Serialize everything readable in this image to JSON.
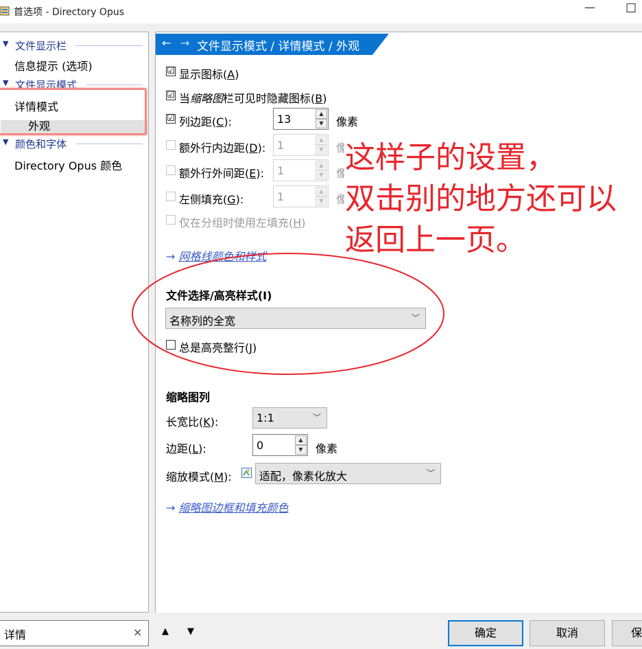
{
  "window": {
    "title": "首选项 - Directory Opus",
    "minimize": "—",
    "maximize": "☐"
  },
  "tree": {
    "groups": [
      {
        "label": "文件显示栏",
        "items": [
          "信息提示 (选项)"
        ]
      },
      {
        "label": "文件显示模式",
        "items": [
          "详情模式"
        ],
        "subitems": [
          "外观"
        ]
      },
      {
        "label": "颜色和字体",
        "items": [
          "Directory Opus 颜色"
        ]
      }
    ]
  },
  "banner": {
    "back": "←",
    "forward": "→",
    "path": "文件显示模式 / 详情模式 / 外观"
  },
  "options": {
    "show_icons": {
      "label": "显示图标(",
      "key": "A",
      "tail": ")",
      "checked": "☑"
    },
    "hide_icons": {
      "prefix": "当",
      "italic": "缩略图",
      "label": "栏可见时隐藏图标(",
      "key": "B",
      "tail": ")",
      "checked": "☑"
    },
    "column_margin": {
      "label": "列边距(",
      "key": "C",
      "tail": "):",
      "value": "13",
      "unit": "像素",
      "checked": "☑"
    },
    "extra_inner": {
      "label": "额外行内边距(",
      "key": "D",
      "tail": "):",
      "value": "1",
      "unit": "像素"
    },
    "extra_outer": {
      "label": "额外行外间距(",
      "key": "E",
      "tail": "):",
      "value": "1",
      "unit": "像素"
    },
    "left_pad": {
      "label": "左侧填充(",
      "key": "G",
      "tail": "):",
      "value": "1",
      "unit": "像素"
    },
    "group_only": {
      "label": "仅在分组时使用左填充(",
      "key": "H",
      "tail": ")"
    }
  },
  "grid_link": {
    "arrow": "→",
    "text": "网格线颜色和样式"
  },
  "selection": {
    "title": "文件选择/高亮样式(I)",
    "value": "名称列的全宽",
    "always_highlight": {
      "label": "总是高亮整行(",
      "key": "J",
      "tail": ")"
    }
  },
  "thumbnails": {
    "title": "缩略图列",
    "aspect": {
      "label": "长宽比(",
      "key": "K",
      "tail": "):",
      "value": "1:1"
    },
    "margin": {
      "label": "边距(",
      "key": "L",
      "tail": "):",
      "value": "0",
      "unit": "像素"
    },
    "zoom": {
      "label": "缩放模式(",
      "key": "M",
      "tail": "):",
      "value": "适配，像素化放大"
    }
  },
  "thumb_link": {
    "arrow": "→",
    "text": "缩略图边框和填充颜色"
  },
  "bottom": {
    "search_value": "详情",
    "clear": "×",
    "up": "🡅",
    "down": "🡇",
    "ok": "确定",
    "cancel": "取消",
    "save": "保"
  },
  "annotation": {
    "lines": [
      "这样子的设置，",
      "双击别的地方还可以",
      "返回上一页。"
    ],
    "color": "#e8262c"
  },
  "colors": {
    "banner": "#0b74d1",
    "tree_header": "#1f3a93",
    "link": "#3a5bc7"
  }
}
